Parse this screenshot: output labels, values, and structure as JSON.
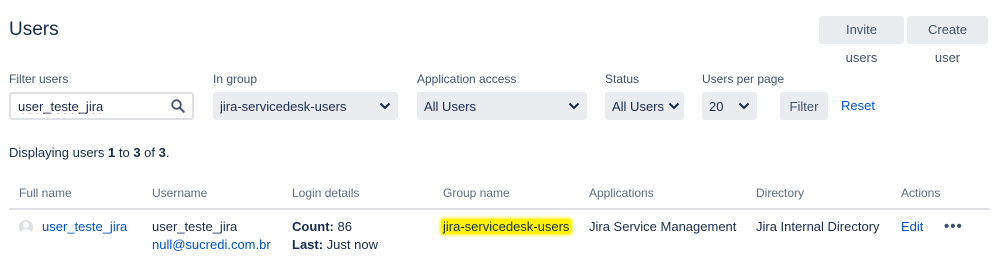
{
  "page": {
    "title": "Users"
  },
  "header_actions": {
    "invite_users": "Invite users",
    "create_user": "Create user"
  },
  "filters": {
    "filter_users": {
      "label": "Filter users",
      "value": "user_teste_jira",
      "icon": "search-icon"
    },
    "in_group": {
      "label": "In group",
      "value": "jira-servicedesk-users"
    },
    "application_access": {
      "label": "Application access",
      "value": "All Users"
    },
    "status": {
      "label": "Status",
      "value": "All Users"
    },
    "users_per_page": {
      "label": "Users per page",
      "value": "20"
    },
    "filter_button": "Filter",
    "reset_link": "Reset"
  },
  "summary": {
    "prefix": "Displaying users ",
    "from": "1",
    "to_word": " to ",
    "to": "3",
    "of_word": " of ",
    "total": "3",
    "suffix": "."
  },
  "table": {
    "columns": [
      "Full name",
      "Username",
      "Login details",
      "Group name",
      "Applications",
      "Directory",
      "Actions"
    ],
    "rows": [
      {
        "full_name": "user_teste_jira",
        "username": "user_teste_jira",
        "email": "null@sucredi.com.br",
        "login_count_label": "Count:",
        "login_count": " 86",
        "last_label": "Last:",
        "last_value": " Just now",
        "group_name": "jira-servicedesk-users",
        "applications": "Jira Service Management",
        "directory": "Jira Internal Directory",
        "edit": "Edit",
        "more_icon": "more-icon"
      }
    ]
  },
  "colors": {
    "link": "#0052cc",
    "text": "#172b4d",
    "highlight": "#fff200",
    "button_bg": "#ebecf0"
  }
}
